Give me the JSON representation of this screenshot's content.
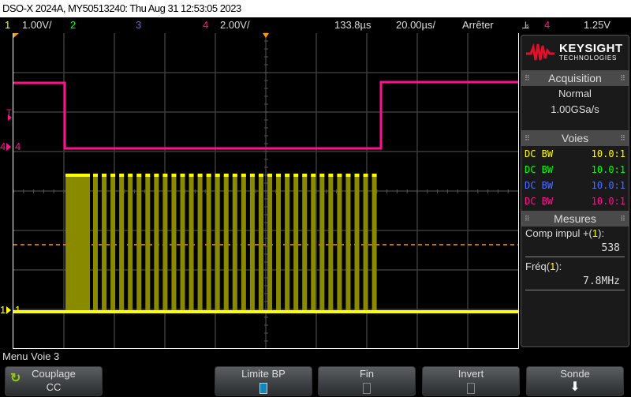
{
  "title": "DSO-X 2024A, MY50513240: Thu Aug 31 12:53:05 2023",
  "topbar": {
    "ch1": "1",
    "ch1_scale": "1.00V/",
    "ch2": "2",
    "ch3": "3",
    "ch4": "4",
    "ch4_scale": "2.00V/",
    "delay": "133.8µs",
    "timebase": "20.00µs/",
    "run_state": "Arrêter",
    "trigger_icon": "⫡",
    "trigger_source": "4",
    "trigger_level": "1.25V"
  },
  "colors": {
    "ch1": "#ffff00",
    "ch2": "#00ff00",
    "ch3": "#5070ff",
    "ch4": "#ff1090",
    "trigger": "#ff9900"
  },
  "markers": {
    "ch4": "4",
    "ch1": "1",
    "trigger": "T"
  },
  "panel": {
    "brand": "KEYSIGHT",
    "brand_sub": "TECHNOLOGIES",
    "acquisition": {
      "title": "Acquisition",
      "mode": "Normal",
      "rate": "1.00GSa/s"
    },
    "voies": {
      "title": "Voies",
      "rows": [
        {
          "coupling": "DC BW",
          "probe": "10.0:1"
        },
        {
          "coupling": "DC BW",
          "probe": "10.0:1"
        },
        {
          "coupling": "DC BW",
          "probe": "10.0:1"
        },
        {
          "coupling": "DC BW",
          "probe": "10.0:1"
        }
      ]
    },
    "mesures": {
      "title": "Mesures",
      "items": [
        {
          "label_pre": "Comp impul +(",
          "ch": "1",
          "label_post": "):",
          "value": "538"
        },
        {
          "label_pre": "Fréq(",
          "ch": "1",
          "label_post": "):",
          "value": "7.8MHz"
        }
      ]
    }
  },
  "menu": {
    "title": "Menu Voie 3",
    "softkeys": [
      {
        "label": "Couplage",
        "value": "CC"
      },
      {
        "label": "Limite BP",
        "checked": true
      },
      {
        "label": "Fin",
        "checked": false
      },
      {
        "label": "Invert",
        "checked": false
      },
      {
        "label": "Sonde"
      }
    ]
  }
}
